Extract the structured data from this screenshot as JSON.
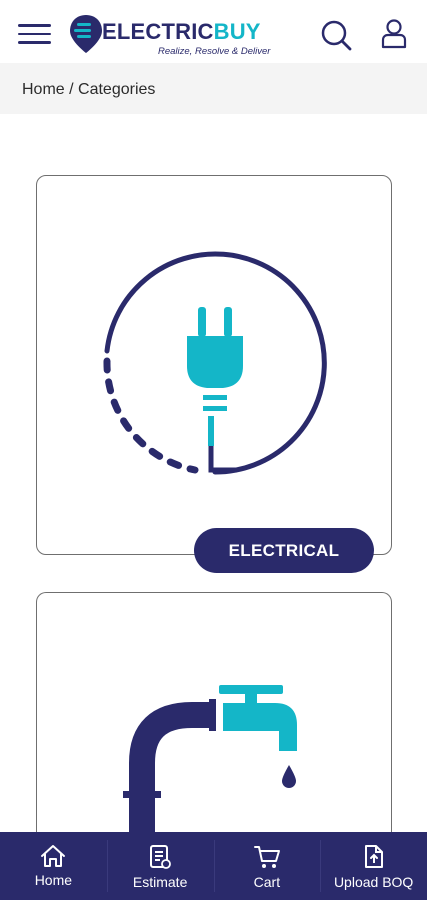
{
  "header": {
    "logo_word_1": "ELECTRIC",
    "logo_word_2": "BUY",
    "logo_tagline": "Realize, Resolve & Deliver"
  },
  "breadcrumb": {
    "home": "Home",
    "separator": " / ",
    "current": "Categories"
  },
  "categories": [
    {
      "label": "ELECTRICAL",
      "icon": "plug-icon"
    },
    {
      "label": "",
      "icon": "water-tap-icon"
    }
  ],
  "bottom_nav": [
    {
      "label": "Home",
      "icon": "home-icon"
    },
    {
      "label": "Estimate",
      "icon": "estimate-icon"
    },
    {
      "label": "Cart",
      "icon": "cart-icon"
    },
    {
      "label": "Upload BOQ",
      "icon": "upload-document-icon"
    }
  ],
  "colors": {
    "brand_navy": "#2a2a6b",
    "brand_teal": "#14b6c8",
    "breadcrumb_bg": "#f4f4f4"
  }
}
